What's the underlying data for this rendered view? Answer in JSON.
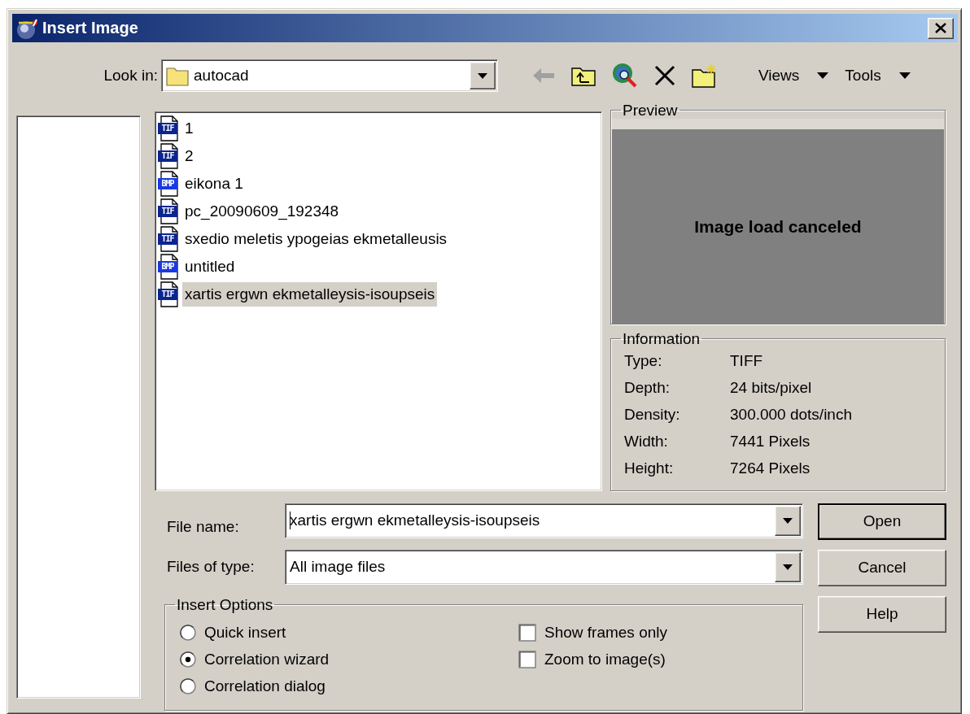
{
  "window": {
    "title": "Insert Image"
  },
  "look_in": {
    "label": "Look in:",
    "value": "autocad"
  },
  "toolbar": {
    "back_disabled": true,
    "menus": [
      {
        "label": "Views"
      },
      {
        "label": "Tools"
      }
    ]
  },
  "files": [
    {
      "name": "1",
      "badge": "TIF",
      "selected": false
    },
    {
      "name": "2",
      "badge": "TIF",
      "selected": false
    },
    {
      "name": "eikona 1",
      "badge": "BMP",
      "selected": false
    },
    {
      "name": "pc_20090609_192348",
      "badge": "TIF",
      "selected": false
    },
    {
      "name": "sxedio meletis ypogeias ekmetalleusis",
      "badge": "TIF",
      "selected": false
    },
    {
      "name": "untitled",
      "badge": "BMP",
      "selected": false
    },
    {
      "name": "xartis ergwn ekmetalleysis-isoupseis",
      "badge": "TIF",
      "selected": true
    }
  ],
  "preview": {
    "title": "Preview",
    "message": "Image load canceled"
  },
  "information": {
    "title": "Information",
    "rows": [
      {
        "label": "Type:",
        "value": "TIFF"
      },
      {
        "label": "Depth:",
        "value": "24 bits/pixel"
      },
      {
        "label": "Density:",
        "value": "300.000 dots/inch"
      },
      {
        "label": "Width:",
        "value": "7441 Pixels"
      },
      {
        "label": "Height:",
        "value": "7264 Pixels"
      }
    ]
  },
  "file_name": {
    "label": "File name:",
    "value": "xartis ergwn ekmetalleysis-isoupseis"
  },
  "files_of_type": {
    "label": "Files of type:",
    "value": "All image files"
  },
  "buttons": [
    {
      "label": "Open",
      "default": true
    },
    {
      "label": "Cancel",
      "default": false
    },
    {
      "label": "Help",
      "default": false
    }
  ],
  "insert_options": {
    "title": "Insert Options",
    "radios": [
      {
        "label": "Quick insert",
        "selected": false
      },
      {
        "label": "Correlation wizard",
        "selected": true
      },
      {
        "label": "Correlation dialog",
        "selected": false
      }
    ],
    "checkboxes": [
      {
        "label": "Show frames only",
        "checked": false
      },
      {
        "label": "Zoom to image(s)",
        "checked": false
      }
    ]
  }
}
